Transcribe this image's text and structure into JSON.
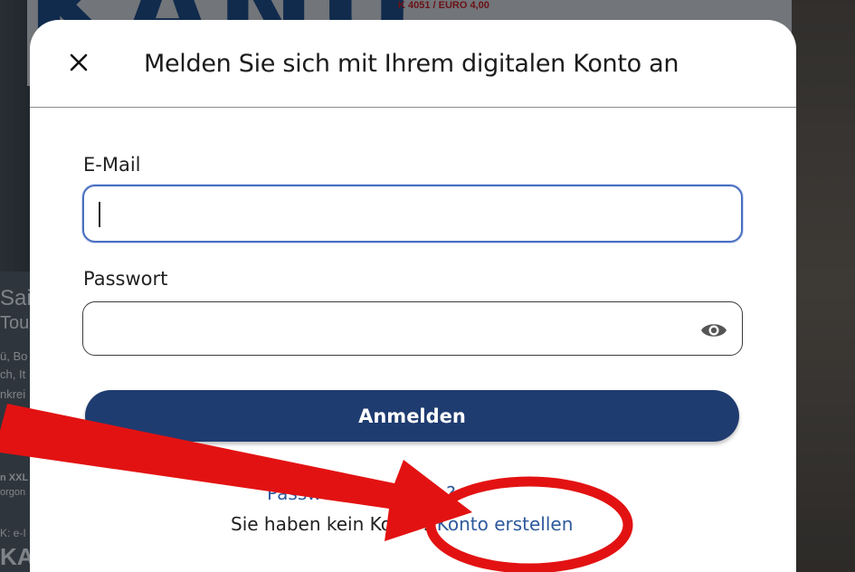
{
  "background": {
    "brand_text": "KANU",
    "price_text": "K 4051 / EURO 4,00",
    "left_snippets": [
      "Sais",
      "Tou",
      "ü, Bo",
      "ch, It",
      "nkrei",
      "n XXL",
      "orgon",
      "K: e-I",
      "KA"
    ]
  },
  "modal": {
    "title": "Melden Sie sich mit Ihrem digitalen Konto an",
    "close_icon": "close-icon",
    "email": {
      "label": "E-Mail",
      "value": ""
    },
    "password": {
      "label": "Passwort",
      "value": "",
      "icon": "eye-icon"
    },
    "submit_label": "Anmelden",
    "forgot_label": "Passwort vergessen?",
    "signup_prompt": "Sie haben kein Konto? ",
    "signup_link": "Konto erstellen"
  },
  "annotation": {
    "arrow_color": "#e31212",
    "circle_color": "#e31212"
  }
}
